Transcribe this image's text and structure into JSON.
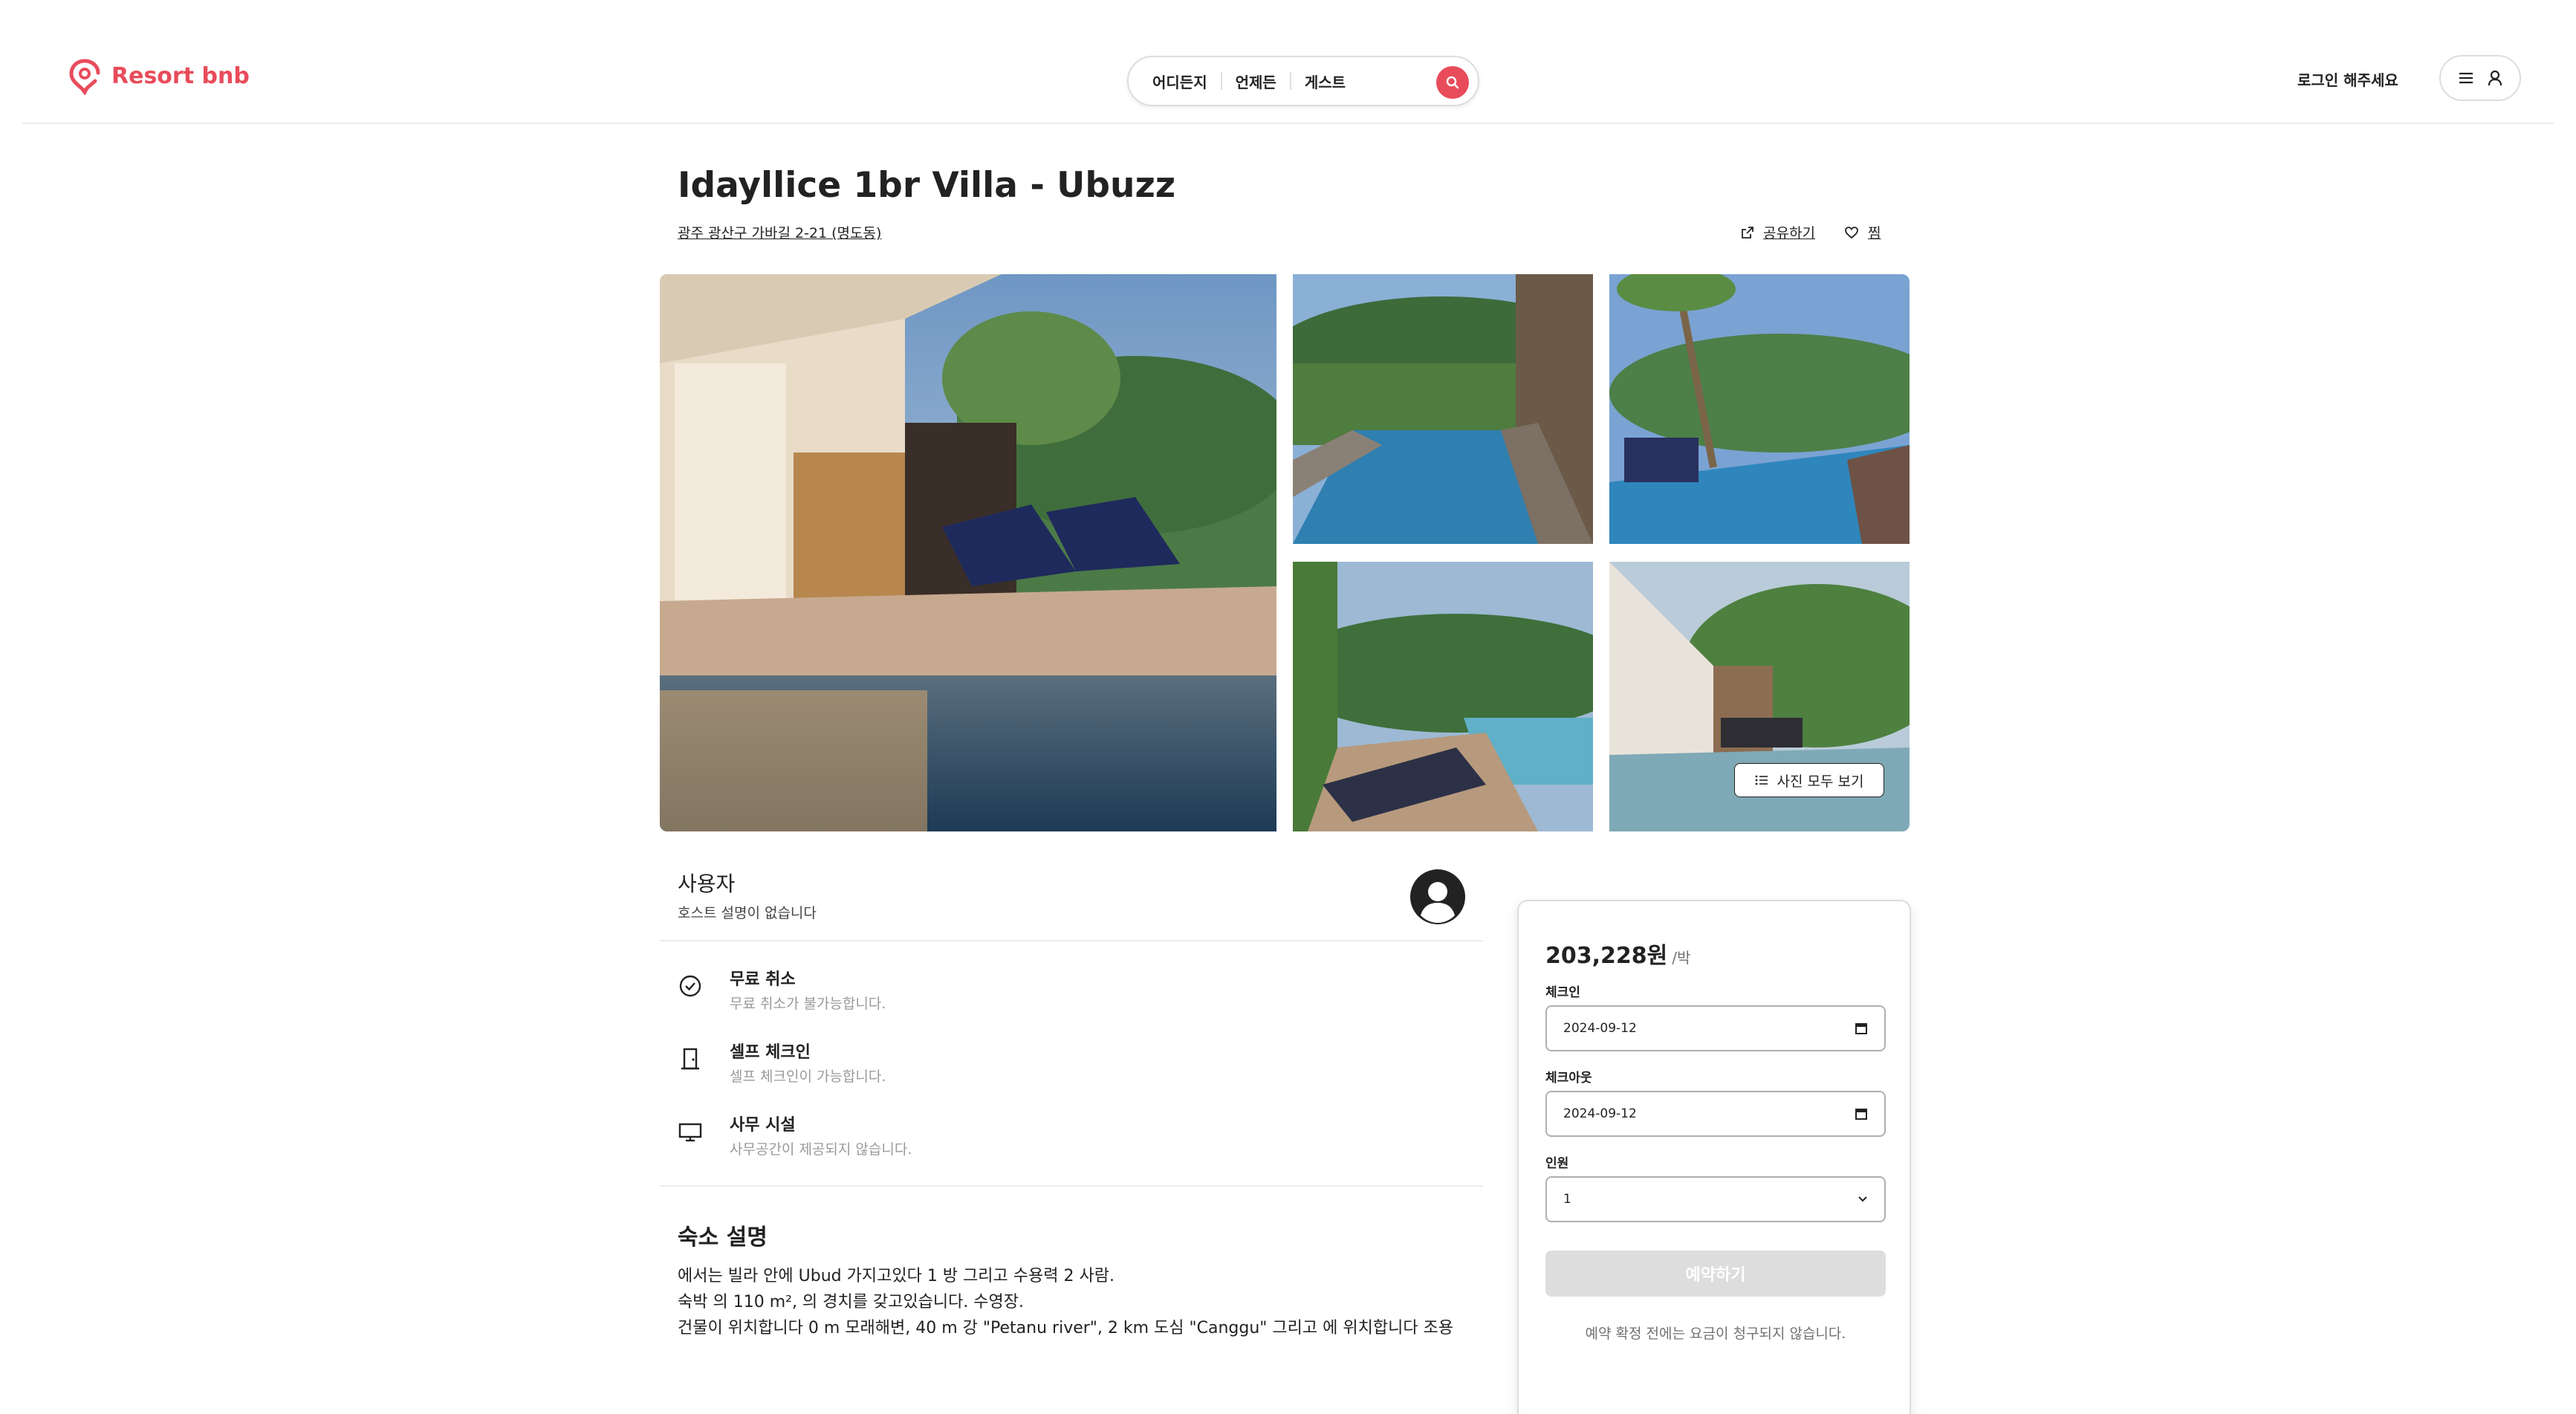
{
  "brand": {
    "name": "Resort bnb",
    "color": "#e84c5b"
  },
  "search": {
    "where": "어디든지",
    "when": "언제든",
    "guests": "게스트",
    "button_icon": "search-icon"
  },
  "header": {
    "login_label": "로그인 해주세요",
    "menu_icon": "menu-icon",
    "user_icon": "user-icon"
  },
  "listing": {
    "title": "Idayllice 1br Villa - Ubuzz",
    "address": "광주 광산구 가바길 2-21 (명도동)",
    "share_label": "공유하기",
    "save_label": "찜",
    "show_all_photos": "사진 모두 보기"
  },
  "host": {
    "name": "사용자",
    "description": "호스트 설명이 없습니다"
  },
  "features": [
    {
      "icon": "check-circle-icon",
      "title": "무료 취소",
      "description": "무료 취소가 불가능합니다."
    },
    {
      "icon": "door-icon",
      "title": "셀프 체크인",
      "description": "셀프 체크인이 가능합니다."
    },
    {
      "icon": "monitor-icon",
      "title": "사무 시설",
      "description": "사무공간이 제공되지 않습니다."
    }
  ],
  "description": {
    "title": "숙소 설명",
    "lines": [
      "에서는 빌라 안에 Ubud 가지고있다 1 방 그리고 수용력 2 사람.",
      "숙박 의 110 m², 의 경치를 갖고있습니다. 수영장.",
      "건물이 위치합니다 0 m 모래해변, 40 m 강 \"Petanu river\", 2 km 도심 \"Canggu\" 그리고 에 위치합니다 조용"
    ]
  },
  "booking": {
    "price": "203,228원",
    "per_night": "/박",
    "checkin_label": "체크인",
    "checkin_value": "2024-09-12",
    "checkout_label": "체크아웃",
    "checkout_value": "2024-09-12",
    "guests_label": "인원",
    "guests_value": "1",
    "book_button": "예약하기",
    "notice": "예약 확정 전에는 요금이 청구되지 않습니다."
  }
}
